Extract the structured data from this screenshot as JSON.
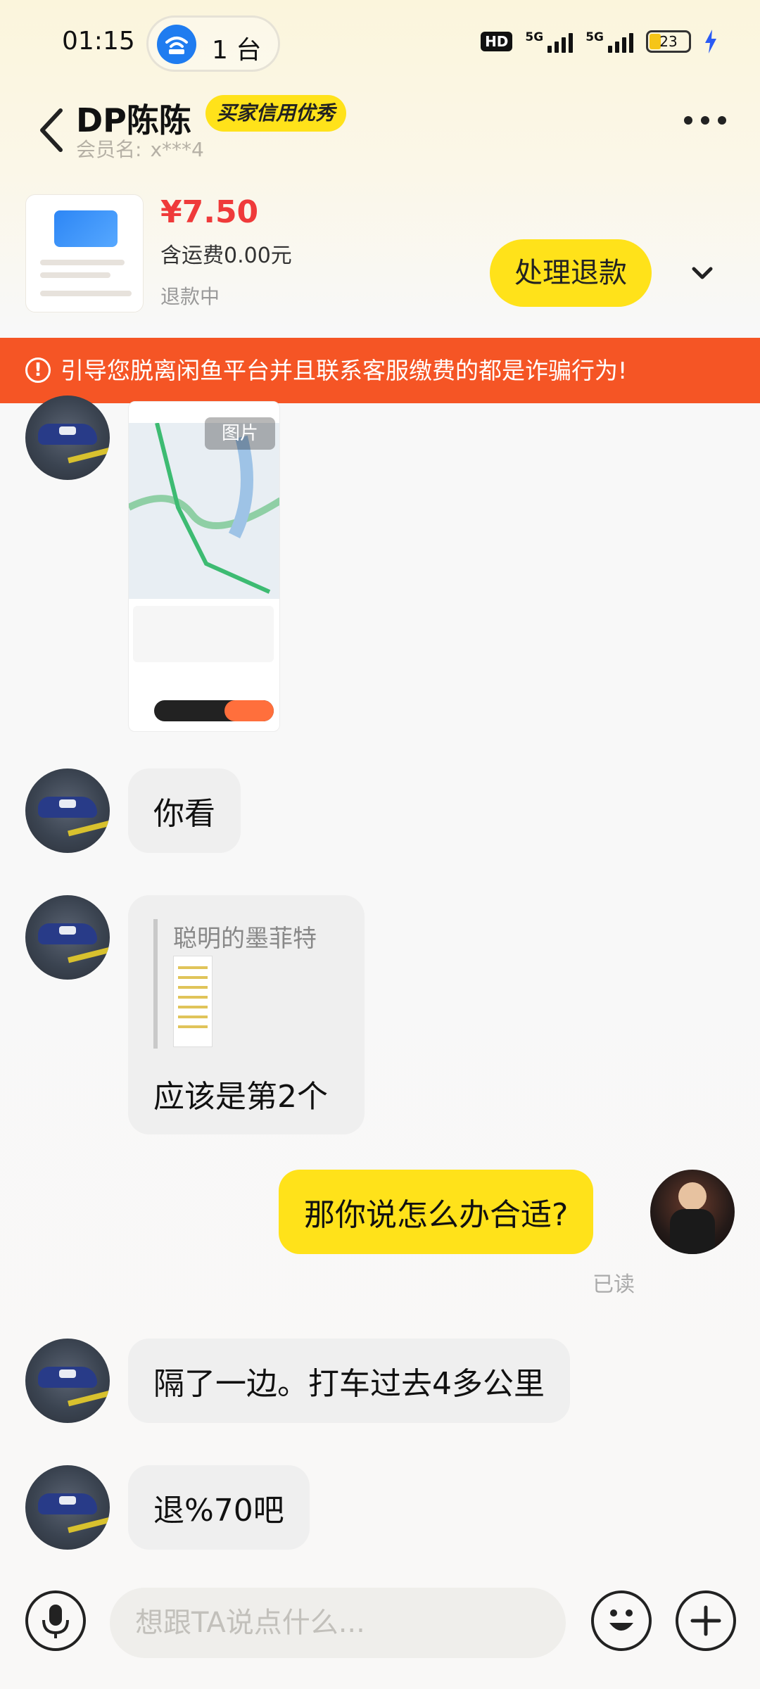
{
  "status_bar": {
    "time": "01:15",
    "hotspot_label": "1 台",
    "hd_label": "HD",
    "signal1_label": "5G",
    "signal2_label": "5G",
    "battery": "23"
  },
  "header": {
    "title": "DP陈陈",
    "credit_badge": "买家信用优秀",
    "member_label": "会员名:",
    "member_value": "x***4"
  },
  "order": {
    "price": "¥7.50",
    "shipping": "含运费0.00元",
    "status": "退款中",
    "refund_button": "处理退款"
  },
  "warning": {
    "icon": "!",
    "text": "引导您脱离闲鱼平台并且联系客服缴费的都是诈骗行为!"
  },
  "chat": {
    "image_label": "图片",
    "msg1": "你看",
    "quote_name": "聪明的墨菲特",
    "quote_reply": "应该是第2个",
    "my_msg": "那你说怎么办合适?",
    "read_status": "已读",
    "msg3": "隔了一边。打车过去4多公里",
    "msg4": "退%70吧"
  },
  "input": {
    "placeholder": "想跟TA说点什么..."
  },
  "colors": {
    "accent_yellow": "#ffe21a",
    "warning_orange": "#f55525",
    "price_red": "#ef3a3a"
  },
  "icons": [
    "back-icon",
    "more-icon",
    "chevron-down-icon",
    "hotspot-icon",
    "microphone-icon",
    "emoji-icon",
    "plus-icon",
    "warning-icon"
  ]
}
